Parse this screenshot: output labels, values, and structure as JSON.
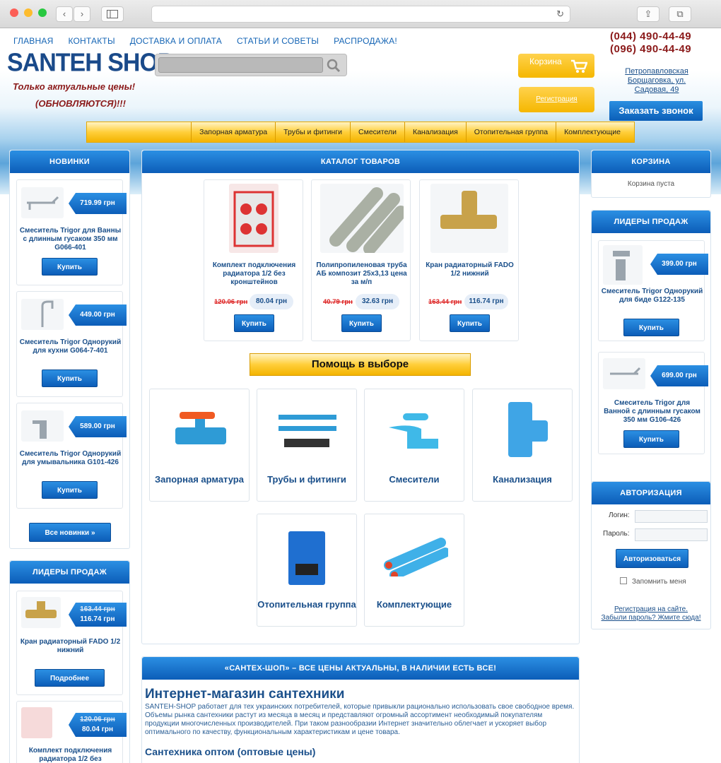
{
  "browser": {
    "icons": [
      "back-icon",
      "forward-icon",
      "sidebar-icon",
      "reload-icon",
      "share-icon",
      "tabs-icon"
    ]
  },
  "top_nav": [
    "ГЛАВНАЯ",
    "КОНТАКТЫ",
    "ДОСТАВКА И ОПЛАТА",
    "СТАТЬИ И СОВЕТЫ",
    "РАСПРОДАЖА!"
  ],
  "header": {
    "phone1": "(044) 490-44-49",
    "phone2": "(096) 490-44-49",
    "logo": "SANTEH SHOP",
    "slogan1": "Только актуальные цены!",
    "slogan2": "(ОБНОВЛЯЮТСЯ)!!!",
    "search_placeholder": "",
    "cart_label": "Корзина",
    "register_label": "Регистрация",
    "address": "Петропавловская Борщаговка, ул. Садовая, 49",
    "callback_label": "Заказать звонок"
  },
  "category_nav": [
    "Запорная арматура",
    "Трубы и фитинги",
    "Смесители",
    "Канализация",
    "Отопительная группа",
    "Комплектующие"
  ],
  "left": {
    "new_title": "НОВИНКИ",
    "new_items": [
      {
        "name": "Смеситель Trigor для Ванны с длинным гусаком 350 мм G066-401",
        "price": "719.99 грн",
        "buy": "Купить"
      },
      {
        "name": "Смеситель Trigor Однорукий для кухни G064-7-401",
        "price": "449.00 грн",
        "buy": "Купить"
      },
      {
        "name": "Смеситель Trigor Однорукий для умывальника G101-426",
        "price": "589.00 грн",
        "buy": "Купить"
      }
    ],
    "all_new": "Все новинки »",
    "leaders_title": "ЛИДЕРЫ ПРОДАЖ",
    "leaders": [
      {
        "name": "Кран радиаторный FADO 1/2 нижний",
        "old": "163.44 грн",
        "price": "116.74 грн",
        "more": "Подробнее"
      },
      {
        "name": "Комплект подключения радиатора 1/2 без",
        "old": "120.06 грн",
        "price": "80.04 грн"
      }
    ]
  },
  "catalog": {
    "title": "КАТАЛОГ ТОВАРОВ",
    "products": [
      {
        "name": "Комплект подключения радиатора 1/2 без кронштейнов",
        "old": "120.06 грн",
        "price": "80.04 грн",
        "buy": "Купить"
      },
      {
        "name": "Полипропиленовая труба АБ композит 25х3,13 цена за м/п",
        "old": "40.79 грн",
        "price": "32.63 грн",
        "buy": "Купить"
      },
      {
        "name": "Кран радиаторный FADO 1/2 нижний",
        "old": "163.44 грн",
        "price": "116.74 грн",
        "buy": "Купить"
      }
    ],
    "help_title": "Помощь в выборе",
    "categories": [
      "Запорная арматура",
      "Трубы и фитинги",
      "Смесители",
      "Канализация",
      "Отопительная группа",
      "Комплектующие"
    ]
  },
  "about": {
    "banner": "«САНТЕХ-ШОП» – ВСЕ ЦЕНЫ АКТУАЛЬНЫ, В НАЛИЧИИ ЕСТЬ ВСЕ!",
    "heading": "Интернет-магазин сантехники",
    "text": "SANTEH-SHOP работает для тех украинских потребителей, которые привыкли рационально использовать свое свободное время. Объемы рынка сантехники растут из месяца в месяц и представляют огромный ассортимент необходимый покупателям продукции многочисленных производителей. При таком разнообразии Интернет значительно облегчает и ускоряет выбор оптимального по качеству, функциональным характеристикам и цене товара.",
    "subheading": "Сантехника оптом (оптовые цены)"
  },
  "right": {
    "cart_title": "КОРЗИНА",
    "cart_empty": "Корзина пуста",
    "leaders_title": "ЛИДЕРЫ ПРОДАЖ",
    "leaders": [
      {
        "name": "Смеситель Trigor Однорукий для биде G122-135",
        "price": "399.00 грн",
        "buy": "Купить"
      },
      {
        "name": "Смеситель Trigor для Ванной с длинным гусаком 350 мм G106-426",
        "price": "699.00 грн",
        "buy": "Купить"
      }
    ],
    "auth_title": "АВТОРИЗАЦИЯ",
    "login_label": "Логин:",
    "password_label": "Пароль:",
    "login_button": "Авторизоваться",
    "remember": "Запомнить меня",
    "register_link": "Регистрация на сайте.",
    "forgot_link": "Забыли пароль? Жмите сюда!"
  }
}
